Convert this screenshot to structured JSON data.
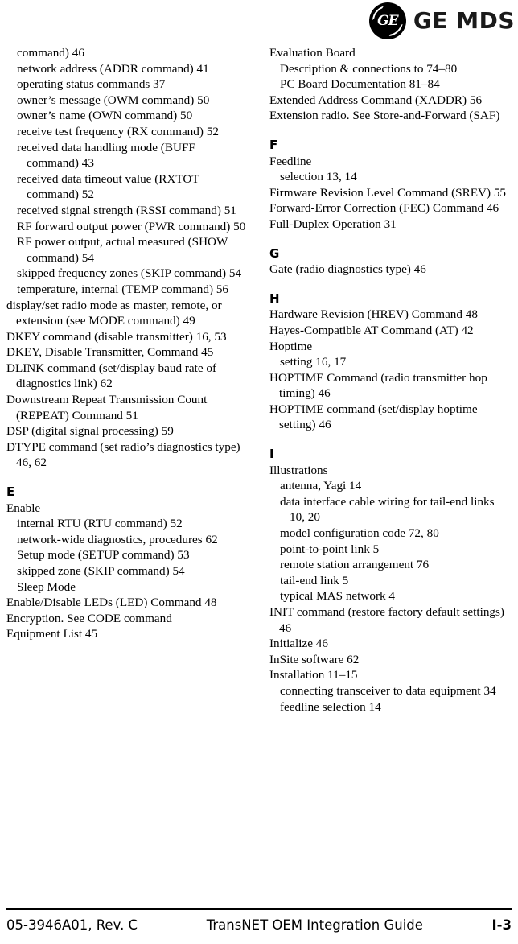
{
  "header": {
    "logo_monogram_text": "GE",
    "logo_wordmark": "GE MDS",
    "logo_icon_name": "ge-roundel-logo"
  },
  "index": {
    "left_column": [
      {
        "type": "entry",
        "level": 1,
        "text": "command)  46"
      },
      {
        "type": "entry",
        "level": 1,
        "text": "network address (ADDR command)  41"
      },
      {
        "type": "entry",
        "level": 1,
        "text": "operating status commands  37"
      },
      {
        "type": "entry",
        "level": 1,
        "text": "owner’s message (OWM command)  50"
      },
      {
        "type": "entry",
        "level": 1,
        "text": "owner’s name (OWN command)  50"
      },
      {
        "type": "entry",
        "level": 1,
        "text": "receive test frequency (RX command)  52"
      },
      {
        "type": "entry",
        "level": 1,
        "text": "received data handling mode (BUFF command)  43"
      },
      {
        "type": "entry",
        "level": 1,
        "text": "received data timeout value (RXTOT command)  52"
      },
      {
        "type": "entry",
        "level": 1,
        "text": "received signal strength (RSSI command)  51"
      },
      {
        "type": "entry",
        "level": 1,
        "text": "RF forward output power (PWR command)  50"
      },
      {
        "type": "entry",
        "level": 1,
        "text": "RF power output, actual measured (SHOW command)  54"
      },
      {
        "type": "entry",
        "level": 1,
        "text": "skipped frequency zones (SKIP command)  54"
      },
      {
        "type": "entry",
        "level": 1,
        "text": "temperature, internal (TEMP command)  56"
      },
      {
        "type": "entry",
        "level": 0,
        "text": "display/set radio mode as master, remote, or extension (see MODE command)  49"
      },
      {
        "type": "entry",
        "level": 0,
        "text": "DKEY command (disable transmitter)  16, 53"
      },
      {
        "type": "entry",
        "level": 0,
        "text": "DKEY, Disable Transmitter, Command  45"
      },
      {
        "type": "entry",
        "level": 0,
        "text": "DLINK command (set/display baud rate of diagnostics link)  62"
      },
      {
        "type": "entry",
        "level": 0,
        "text": "Downstream Repeat Transmission Count (REPEAT) Command  51"
      },
      {
        "type": "entry",
        "level": 0,
        "text": "DSP (digital signal processing)  59"
      },
      {
        "type": "entry",
        "level": 0,
        "text": "DTYPE command (set radio’s diagnostics type)  46, 62"
      },
      {
        "type": "heading",
        "text": "E"
      },
      {
        "type": "entry",
        "level": 0,
        "text": "Enable"
      },
      {
        "type": "entry",
        "level": 1,
        "text": "internal RTU (RTU command)  52"
      },
      {
        "type": "entry",
        "level": 1,
        "text": "network-wide diagnostics, procedures  62"
      },
      {
        "type": "entry",
        "level": 1,
        "text": "Setup mode (SETUP command)  53"
      },
      {
        "type": "entry",
        "level": 1,
        "text": "skipped zone (SKIP command)  54"
      },
      {
        "type": "entry",
        "level": 1,
        "text": "Sleep Mode"
      },
      {
        "type": "entry",
        "level": 0,
        "text": "Enable/Disable LEDs (LED) Command  48"
      },
      {
        "type": "entry",
        "level": 0,
        "text": "Encryption. See CODE command"
      },
      {
        "type": "entry",
        "level": 0,
        "text": "Equipment List  45"
      }
    ],
    "right_column": [
      {
        "type": "entry",
        "level": 0,
        "text": "Evaluation Board"
      },
      {
        "type": "entry",
        "level": 1,
        "text": "Description & connections to  74–80"
      },
      {
        "type": "entry",
        "level": 1,
        "text": "PC Board Documentation  81–84"
      },
      {
        "type": "entry",
        "level": 0,
        "text": "Extended Address Command (XADDR)  56"
      },
      {
        "type": "entry",
        "level": 0,
        "text": "Extension radio. See Store-and-Forward (SAF)"
      },
      {
        "type": "heading",
        "text": "F"
      },
      {
        "type": "entry",
        "level": 0,
        "text": "Feedline"
      },
      {
        "type": "entry",
        "level": 1,
        "text": "selection  13, 14"
      },
      {
        "type": "entry",
        "level": 0,
        "text": "Firmware Revision Level Command (SREV)  55"
      },
      {
        "type": "entry",
        "level": 0,
        "text": "Forward-Error Correction (FEC) Command  46"
      },
      {
        "type": "entry",
        "level": 0,
        "text": "Full-Duplex Operation  31"
      },
      {
        "type": "heading",
        "text": "G"
      },
      {
        "type": "entry",
        "level": 0,
        "text": "Gate (radio diagnostics type)  46"
      },
      {
        "type": "heading",
        "text": "H"
      },
      {
        "type": "entry",
        "level": 0,
        "text": "Hardware Revision (HREV) Command  48"
      },
      {
        "type": "entry",
        "level": 0,
        "text": "Hayes-Compatible AT Command (AT)  42"
      },
      {
        "type": "entry",
        "level": 0,
        "text": "Hoptime"
      },
      {
        "type": "entry",
        "level": 1,
        "text": "setting  16, 17"
      },
      {
        "type": "entry",
        "level": 0,
        "text": "HOPTIME Command (radio transmitter hop timing)  46"
      },
      {
        "type": "entry",
        "level": 0,
        "text": "HOPTIME command (set/display hoptime setting)  46"
      },
      {
        "type": "heading",
        "text": "I"
      },
      {
        "type": "entry",
        "level": 0,
        "text": "Illustrations"
      },
      {
        "type": "entry",
        "level": 1,
        "text": "antenna, Yagi  14"
      },
      {
        "type": "entry",
        "level": 1,
        "text": "data interface cable wiring for tail-end links  10, 20"
      },
      {
        "type": "entry",
        "level": 1,
        "text": "model configuration code  72, 80"
      },
      {
        "type": "entry",
        "level": 1,
        "text": "point-to-point link  5"
      },
      {
        "type": "entry",
        "level": 1,
        "text": "remote station arrangement  76"
      },
      {
        "type": "entry",
        "level": 1,
        "text": "tail-end link  5"
      },
      {
        "type": "entry",
        "level": 1,
        "text": "typical MAS network  4"
      },
      {
        "type": "entry",
        "level": 0,
        "text": "INIT command (restore factory default settings)  46"
      },
      {
        "type": "entry",
        "level": 0,
        "text": "Initialize  46"
      },
      {
        "type": "entry",
        "level": 0,
        "text": "InSite software  62"
      },
      {
        "type": "entry",
        "level": 0,
        "text": "Installation  11–15"
      },
      {
        "type": "entry",
        "level": 1,
        "text": "connecting transceiver to data equipment  34"
      },
      {
        "type": "entry",
        "level": 1,
        "text": "feedline selection  14"
      }
    ]
  },
  "footer": {
    "document_number": "05-3946A01, Rev.  C",
    "title": "TransNET OEM Integration Guide",
    "page_number": "I-3"
  }
}
